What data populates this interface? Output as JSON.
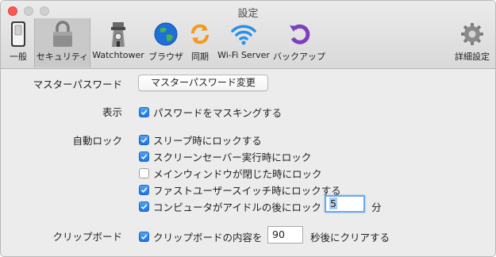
{
  "window": {
    "title": "設定"
  },
  "toolbar": {
    "items": [
      {
        "label": "一般",
        "icon": "switch-icon"
      },
      {
        "label": "セキュリティ",
        "icon": "padlock-icon",
        "selected": true
      },
      {
        "label": "Watchtower",
        "icon": "watchtower-icon"
      },
      {
        "label": "ブラウザ",
        "icon": "globe-icon"
      },
      {
        "label": "同期",
        "icon": "sync-icon"
      },
      {
        "label": "Wi-Fi Server",
        "icon": "wifi-icon"
      },
      {
        "label": "バックアップ",
        "icon": "backup-icon"
      },
      {
        "label": "詳細設定",
        "icon": "gear-icon"
      }
    ]
  },
  "security": {
    "master_password": {
      "label": "マスターパスワード",
      "button": "マスターパスワード変更"
    },
    "display": {
      "label": "表示",
      "mask_passwords": {
        "label": "パスワードをマスキングする",
        "checked": true
      }
    },
    "auto_lock": {
      "label": "自動ロック",
      "options": [
        {
          "label": "スリープ時にロックする",
          "checked": true
        },
        {
          "label": "スクリーンセーバー実行時にロック",
          "checked": true
        },
        {
          "label": "メインウィンドウが閉じた時にロック",
          "checked": false
        },
        {
          "label": "ファストユーザースイッチ時にロックする",
          "checked": true
        },
        {
          "label": "コンピュータがアイドルの後にロック",
          "checked": true
        }
      ],
      "idle_minutes": "5",
      "idle_unit": "分"
    },
    "clipboard": {
      "label": "クリップボード",
      "clear": {
        "label": "クリップボードの内容を",
        "checked": true
      },
      "seconds": "90",
      "suffix": "秒後にクリアする"
    }
  },
  "colors": {
    "accent": "#1f75e4",
    "close": "#fc5753",
    "selected_tab": "#c9c9c9"
  }
}
